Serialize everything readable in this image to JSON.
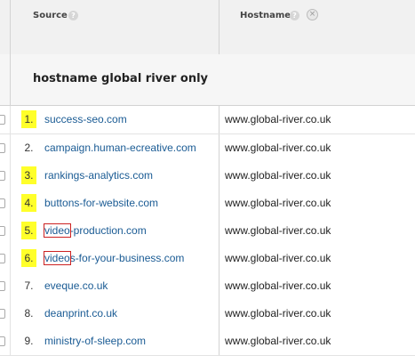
{
  "header": {
    "source_label": "Source",
    "hostname_label": "Hostname",
    "help_glyph": "?",
    "close_glyph": "×"
  },
  "segment": {
    "title": "hostname global river only"
  },
  "highlight_color": "#ffff2a",
  "link_color": "#1a5b94",
  "rows": [
    {
      "num": "1.",
      "source_pre": "",
      "source_boxed": "",
      "source": "success-seo.com",
      "host": "www.global-river.co.uk"
    },
    {
      "num": "2.",
      "source_pre": "",
      "source_boxed": "",
      "source": "campaign.human-ecreative.com",
      "host": "www.global-river.co.uk"
    },
    {
      "num": "3.",
      "source_pre": "",
      "source_boxed": "",
      "source": "rankings-analytics.com",
      "host": "www.global-river.co.uk"
    },
    {
      "num": "4.",
      "source_pre": "",
      "source_boxed": "",
      "source": "buttons-for-website.com",
      "host": "www.global-river.co.uk"
    },
    {
      "num": "5.",
      "source_pre": "",
      "source_boxed": "video",
      "source": "-production.com",
      "host": "www.global-river.co.uk"
    },
    {
      "num": "6.",
      "source_pre": "",
      "source_boxed": "video",
      "source": "s-for-your-business.com",
      "host": "www.global-river.co.uk"
    },
    {
      "num": "7.",
      "source_pre": "",
      "source_boxed": "",
      "source": "eveque.co.uk",
      "host": "www.global-river.co.uk"
    },
    {
      "num": "8.",
      "source_pre": "",
      "source_boxed": "",
      "source": "deanprint.co.uk",
      "host": "www.global-river.co.uk"
    },
    {
      "num": "9.",
      "source_pre": "",
      "source_boxed": "",
      "source": "ministry-of-sleep.com",
      "host": "www.global-river.co.uk"
    }
  ]
}
